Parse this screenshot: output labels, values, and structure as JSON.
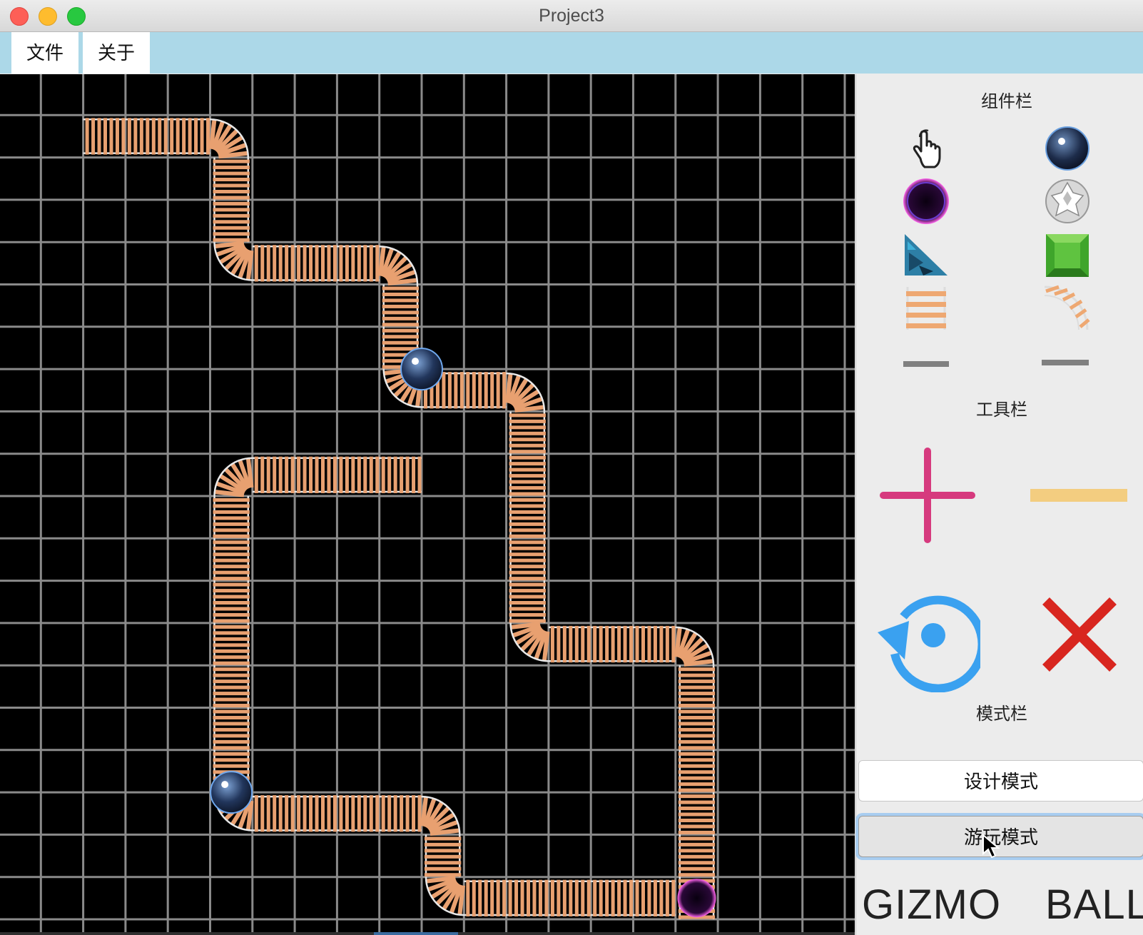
{
  "window": {
    "title": "Project3"
  },
  "menu": [
    {
      "label": "文件"
    },
    {
      "label": "关于"
    }
  ],
  "panel": {
    "components_title": "组件栏",
    "components": [
      {
        "name": "hand-cursor-icon"
      },
      {
        "name": "ball-icon"
      },
      {
        "name": "absorber-icon"
      },
      {
        "name": "circle-bumper-icon"
      },
      {
        "name": "triangle-bumper-icon"
      },
      {
        "name": "square-bumper-icon"
      },
      {
        "name": "straight-track-icon"
      },
      {
        "name": "curved-track-icon"
      },
      {
        "name": "left-flipper-icon"
      },
      {
        "name": "right-flipper-icon"
      }
    ],
    "tools_title": "工具栏",
    "tools": [
      {
        "name": "enlarge-icon",
        "color": "#d63a7e"
      },
      {
        "name": "shrink-icon",
        "color": "#f3cd80"
      },
      {
        "name": "rotate-icon",
        "color": "#3aa1f0"
      },
      {
        "name": "delete-icon",
        "color": "#d8261f"
      }
    ],
    "mode_title": "模式栏",
    "modes": {
      "design": "设计模式",
      "play": "游玩模式"
    },
    "logo": {
      "left": "GIZMO",
      "right": "BALL"
    }
  },
  "board": {
    "grid_cols": 20,
    "grid_rows": 21,
    "colors": {
      "grid": "#8a8a8a",
      "tie": "#e8a070",
      "rail": "#e8e8e8",
      "background": "#000000"
    },
    "tracks": [
      {
        "type": "straight",
        "col": 2,
        "row": 1,
        "orient": "h"
      },
      {
        "type": "straight",
        "col": 3,
        "row": 1,
        "orient": "h"
      },
      {
        "type": "straight",
        "col": 4,
        "row": 1,
        "orient": "h"
      },
      {
        "type": "curve",
        "col": 5,
        "row": 1,
        "join": "left-bottom"
      },
      {
        "type": "straight",
        "col": 5,
        "row": 2,
        "orient": "v"
      },
      {
        "type": "straight",
        "col": 5,
        "row": 3,
        "orient": "v"
      },
      {
        "type": "curve",
        "col": 5,
        "row": 4,
        "join": "top-right"
      },
      {
        "type": "straight",
        "col": 6,
        "row": 4,
        "orient": "h"
      },
      {
        "type": "straight",
        "col": 7,
        "row": 4,
        "orient": "h"
      },
      {
        "type": "straight",
        "col": 8,
        "row": 4,
        "orient": "h"
      },
      {
        "type": "curve",
        "col": 9,
        "row": 4,
        "join": "left-bottom"
      },
      {
        "type": "straight",
        "col": 9,
        "row": 5,
        "orient": "v"
      },
      {
        "type": "straight",
        "col": 9,
        "row": 6,
        "orient": "v"
      },
      {
        "type": "curve",
        "col": 9,
        "row": 7,
        "join": "top-right"
      },
      {
        "type": "straight",
        "col": 10,
        "row": 7,
        "orient": "h"
      },
      {
        "type": "straight",
        "col": 11,
        "row": 7,
        "orient": "h"
      },
      {
        "type": "curve",
        "col": 12,
        "row": 7,
        "join": "left-bottom"
      },
      {
        "type": "straight",
        "col": 12,
        "row": 8,
        "orient": "v"
      },
      {
        "type": "straight",
        "col": 12,
        "row": 9,
        "orient": "v"
      },
      {
        "type": "straight",
        "col": 12,
        "row": 10,
        "orient": "v"
      },
      {
        "type": "straight",
        "col": 12,
        "row": 11,
        "orient": "v"
      },
      {
        "type": "straight",
        "col": 12,
        "row": 12,
        "orient": "v"
      },
      {
        "type": "curve",
        "col": 12,
        "row": 13,
        "join": "top-right"
      },
      {
        "type": "straight",
        "col": 13,
        "row": 13,
        "orient": "h"
      },
      {
        "type": "straight",
        "col": 14,
        "row": 13,
        "orient": "h"
      },
      {
        "type": "straight",
        "col": 15,
        "row": 13,
        "orient": "h"
      },
      {
        "type": "curve",
        "col": 16,
        "row": 13,
        "join": "left-bottom"
      },
      {
        "type": "straight",
        "col": 16,
        "row": 14,
        "orient": "v"
      },
      {
        "type": "straight",
        "col": 16,
        "row": 15,
        "orient": "v"
      },
      {
        "type": "straight",
        "col": 16,
        "row": 16,
        "orient": "v"
      },
      {
        "type": "straight",
        "col": 16,
        "row": 17,
        "orient": "v"
      },
      {
        "type": "straight",
        "col": 16,
        "row": 18,
        "orient": "v"
      },
      {
        "type": "straight",
        "col": 16,
        "row": 19,
        "orient": "v"
      },
      {
        "type": "curve",
        "col": 5,
        "row": 9,
        "join": "right-bottom"
      },
      {
        "type": "straight",
        "col": 6,
        "row": 9,
        "orient": "h"
      },
      {
        "type": "straight",
        "col": 7,
        "row": 9,
        "orient": "h"
      },
      {
        "type": "straight",
        "col": 8,
        "row": 9,
        "orient": "h"
      },
      {
        "type": "straight",
        "col": 9,
        "row": 9,
        "orient": "h"
      },
      {
        "type": "straight",
        "col": 5,
        "row": 10,
        "orient": "v"
      },
      {
        "type": "straight",
        "col": 5,
        "row": 11,
        "orient": "v"
      },
      {
        "type": "straight",
        "col": 5,
        "row": 12,
        "orient": "v"
      },
      {
        "type": "straight",
        "col": 5,
        "row": 13,
        "orient": "v"
      },
      {
        "type": "straight",
        "col": 5,
        "row": 14,
        "orient": "v"
      },
      {
        "type": "straight",
        "col": 5,
        "row": 15,
        "orient": "v"
      },
      {
        "type": "straight",
        "col": 5,
        "row": 16,
        "orient": "v"
      },
      {
        "type": "curve",
        "col": 5,
        "row": 17,
        "join": "top-right"
      },
      {
        "type": "straight",
        "col": 6,
        "row": 17,
        "orient": "h"
      },
      {
        "type": "straight",
        "col": 7,
        "row": 17,
        "orient": "h"
      },
      {
        "type": "straight",
        "col": 8,
        "row": 17,
        "orient": "h"
      },
      {
        "type": "curve",
        "col": 10,
        "row": 17,
        "join": "left-bottom"
      },
      {
        "type": "straight",
        "col": 9,
        "row": 17,
        "orient": "h"
      },
      {
        "type": "straight",
        "col": 10,
        "row": 18,
        "orient": "v"
      },
      {
        "type": "curve",
        "col": 10,
        "row": 19,
        "join": "top-right"
      },
      {
        "type": "straight",
        "col": 11,
        "row": 19,
        "orient": "h"
      },
      {
        "type": "straight",
        "col": 12,
        "row": 19,
        "orient": "h"
      },
      {
        "type": "straight",
        "col": 13,
        "row": 19,
        "orient": "h"
      },
      {
        "type": "straight",
        "col": 14,
        "row": 19,
        "orient": "h"
      },
      {
        "type": "straight",
        "col": 15,
        "row": 19,
        "orient": "h"
      }
    ],
    "balls": [
      {
        "col": 9.5,
        "row": 6.5
      },
      {
        "col": 5,
        "row": 16.5
      }
    ],
    "absorbers": [
      {
        "col": 16,
        "row": 19
      }
    ]
  }
}
